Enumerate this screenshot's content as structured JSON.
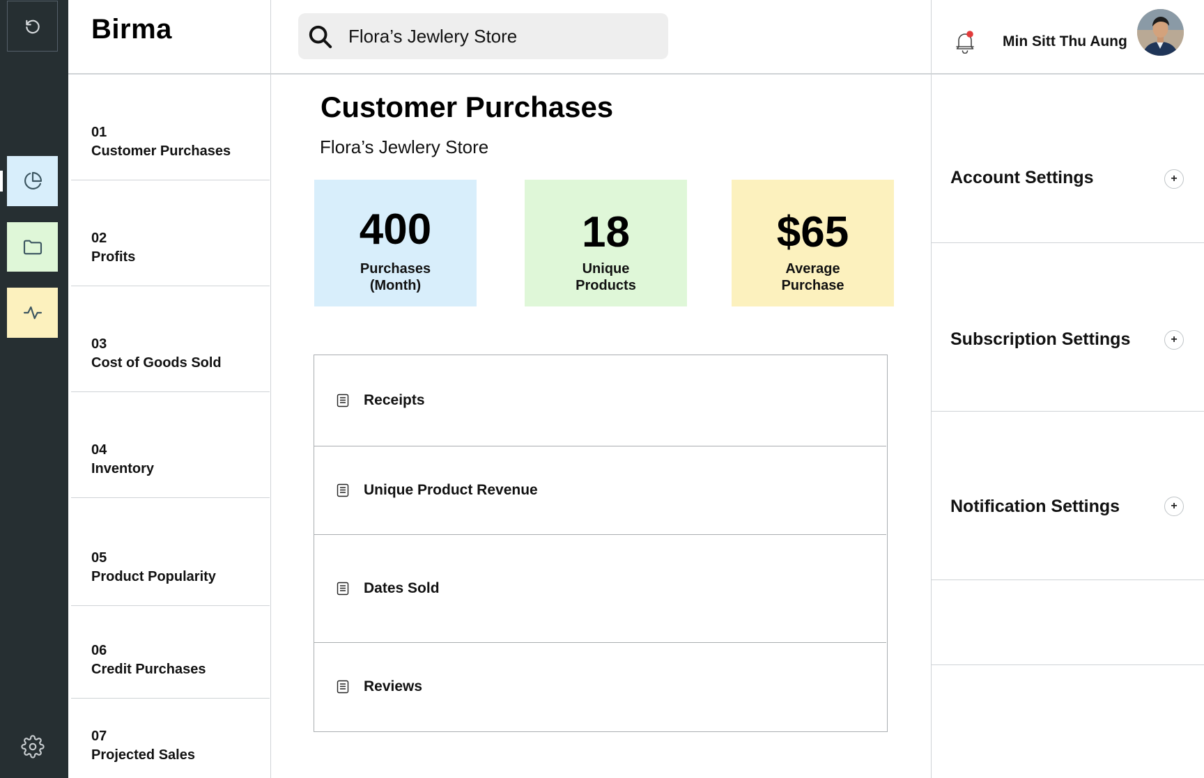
{
  "app": {
    "brand": "Birma"
  },
  "rail": {
    "items": [
      {
        "icon": "refresh-icon"
      },
      {
        "icon": "pie-chart-icon",
        "active": true,
        "bg": "#d8eefb"
      },
      {
        "icon": "folder-icon",
        "bg": "#dff7d8"
      },
      {
        "icon": "activity-icon",
        "bg": "#fcf1be"
      },
      {
        "icon": "gear-icon"
      }
    ]
  },
  "nav": {
    "items": [
      {
        "num": "01",
        "label": "Customer Purchases"
      },
      {
        "num": "02",
        "label": "Profits"
      },
      {
        "num": "03",
        "label": "Cost of Goods Sold"
      },
      {
        "num": "04",
        "label": "Inventory"
      },
      {
        "num": "05",
        "label": "Product Popularity"
      },
      {
        "num": "06",
        "label": "Credit Purchases"
      },
      {
        "num": "07",
        "label": "Projected Sales"
      }
    ]
  },
  "search": {
    "value": "Flora’s Jewlery Store",
    "icon": "search-icon"
  },
  "main": {
    "title": "Customer Purchases",
    "subtitle": "Flora’s Jewlery Store",
    "stats": [
      {
        "value": "400",
        "label_line1": "Purchases",
        "label_line2": "(Month)",
        "color": "#d8eefb"
      },
      {
        "value": "18",
        "label_line1": "Unique",
        "label_line2": "Products",
        "color": "#dff7d8"
      },
      {
        "value": "$65",
        "label_line1": "Average",
        "label_line2": "Purchase",
        "color": "#fcf1be"
      }
    ],
    "rows": [
      {
        "label": "Receipts",
        "icon": "document-icon"
      },
      {
        "label": "Unique Product Revenue",
        "icon": "document-icon"
      },
      {
        "label": "Dates Sold",
        "icon": "document-icon"
      },
      {
        "label": "Reviews",
        "icon": "document-icon"
      }
    ]
  },
  "user": {
    "name": "Min Sitt Thu Aung",
    "notification_dot_color": "#e23b3b"
  },
  "settings": [
    {
      "label": "Account Settings",
      "action": "+"
    },
    {
      "label": "Subscription Settings",
      "action": "+"
    },
    {
      "label": "Notification Settings",
      "action": "+"
    }
  ]
}
